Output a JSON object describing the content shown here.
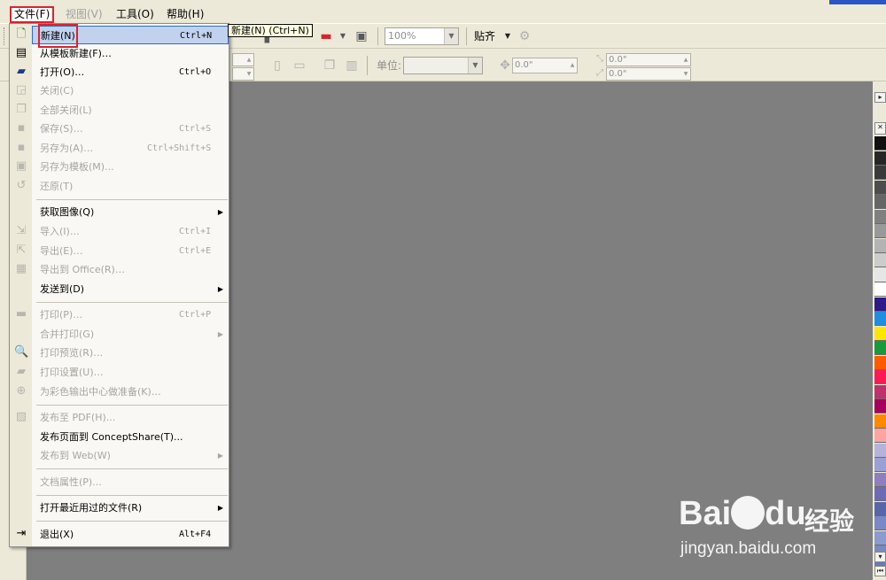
{
  "menubar": {
    "items": [
      {
        "label": "文件(F)",
        "state": "active"
      },
      {
        "label": "视图(V)",
        "state": "disabled"
      },
      {
        "label": "工具(O)",
        "state": "normal"
      },
      {
        "label": "帮助(H)",
        "state": "normal"
      }
    ]
  },
  "toolbar": {
    "zoom_value": "100%",
    "snap_label": "贴齐",
    "unit_label": "单位:",
    "nudge_value": "0.0\"",
    "dup_x": "0.0\"",
    "dup_y": "0.0\""
  },
  "file_menu": {
    "items": [
      {
        "label": "新建(N)",
        "shortcut": "Ctrl+N",
        "icon": "new-doc-icon",
        "state": "highlight"
      },
      {
        "label": "从模板新建(F)…",
        "shortcut": "",
        "icon": "template-icon",
        "state": "normal"
      },
      {
        "label": "打开(O)…",
        "shortcut": "Ctrl+O",
        "icon": "folder-open-icon",
        "state": "normal"
      },
      {
        "label": "关闭(C)",
        "shortcut": "",
        "icon": "close-doc-icon",
        "state": "disabled"
      },
      {
        "label": "全部关闭(L)",
        "shortcut": "",
        "icon": "close-all-icon",
        "state": "disabled"
      },
      {
        "label": "保存(S)…",
        "shortcut": "Ctrl+S",
        "icon": "save-icon",
        "state": "disabled"
      },
      {
        "label": "另存为(A)…",
        "shortcut": "Ctrl+Shift+S",
        "icon": "save-as-icon",
        "state": "disabled"
      },
      {
        "label": "另存为模板(M)...",
        "shortcut": "",
        "icon": "save-template-icon",
        "state": "disabled"
      },
      {
        "label": "还原(T)",
        "shortcut": "",
        "icon": "revert-icon",
        "state": "disabled"
      },
      {
        "label": "获取图像(Q)",
        "shortcut": "",
        "icon": "",
        "state": "submenu"
      },
      {
        "label": "导入(I)…",
        "shortcut": "Ctrl+I",
        "icon": "import-icon",
        "state": "disabled"
      },
      {
        "label": "导出(E)…",
        "shortcut": "Ctrl+E",
        "icon": "export-icon",
        "state": "disabled"
      },
      {
        "label": "导出到 Office(R)…",
        "shortcut": "",
        "icon": "export-office-icon",
        "state": "disabled"
      },
      {
        "label": "发送到(D)",
        "shortcut": "",
        "icon": "",
        "state": "submenu"
      },
      {
        "label": "打印(P)…",
        "shortcut": "Ctrl+P",
        "icon": "print-icon",
        "state": "disabled"
      },
      {
        "label": "合并打印(G)",
        "shortcut": "",
        "icon": "",
        "state": "disabled-submenu"
      },
      {
        "label": "打印预览(R)…",
        "shortcut": "",
        "icon": "print-preview-icon",
        "state": "disabled"
      },
      {
        "label": "打印设置(U)…",
        "shortcut": "",
        "icon": "print-setup-icon",
        "state": "disabled"
      },
      {
        "label": "为彩色输出中心做准备(K)…",
        "shortcut": "",
        "icon": "color-output-icon",
        "state": "disabled"
      },
      {
        "label": "发布至 PDF(H)...",
        "shortcut": "",
        "icon": "pdf-icon",
        "state": "disabled"
      },
      {
        "label": "发布页面到 ConceptShare(T)...",
        "shortcut": "",
        "icon": "",
        "state": "normal"
      },
      {
        "label": "发布到 Web(W)",
        "shortcut": "",
        "icon": "",
        "state": "disabled-submenu"
      },
      {
        "label": "文档属性(P)...",
        "shortcut": "",
        "icon": "",
        "state": "disabled"
      },
      {
        "label": "打开最近用过的文件(R)",
        "shortcut": "",
        "icon": "",
        "state": "submenu"
      },
      {
        "label": "退出(X)",
        "shortcut": "Alt+F4",
        "icon": "exit-icon",
        "state": "normal"
      }
    ]
  },
  "tooltip": {
    "text": "新建(N) (Ctrl+N)"
  },
  "palette": {
    "colors": [
      "#111111",
      "#262626",
      "#3a3a3a",
      "#4d4d4d",
      "#666666",
      "#808080",
      "#999999",
      "#b3b3b3",
      "#cccccc",
      "#e6e6e6",
      "#ffffff",
      "#2e1a8a",
      "#1e8fe0",
      "#ffe600",
      "#179a3c",
      "#ff5a00",
      "#ff1a55",
      "#c0306a",
      "#a5005c",
      "#ff8a00",
      "#ffa3a3",
      "#b7b2dc",
      "#9aa0d4",
      "#8f7ec0",
      "#6f6ab4",
      "#5865a8",
      "#7888c8",
      "#8c9ad0",
      "#7a89c0",
      "#6b7ab4"
    ]
  },
  "watermark": {
    "brand": "Bai",
    "brand2": "du",
    "product": "经验",
    "url": "jingyan.baidu.com"
  }
}
